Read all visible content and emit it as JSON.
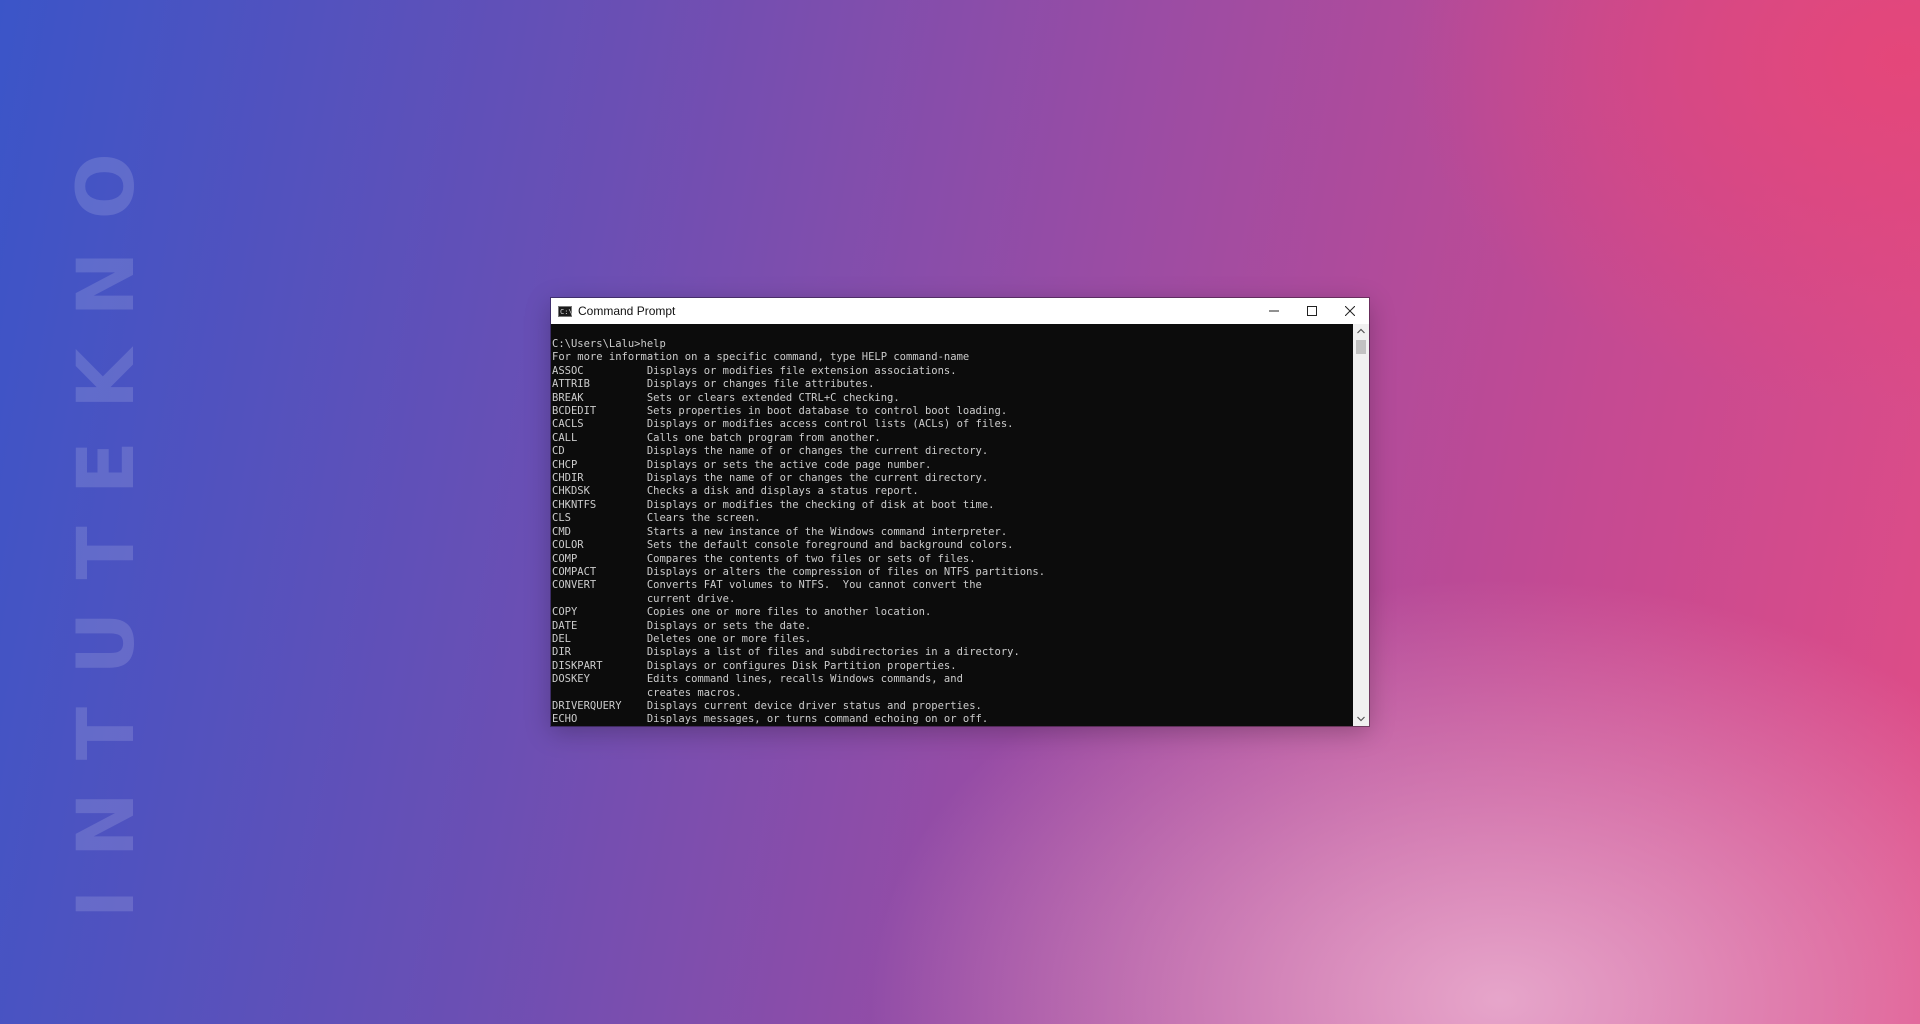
{
  "background": {
    "watermark_text": "INTUTEKNO",
    "colors": [
      "#3b55c8",
      "#9a4ca4",
      "#e04c86",
      "#e8aacd"
    ]
  },
  "window": {
    "title": "Command Prompt",
    "app_icon": "cmd-icon",
    "app_icon_glyph": "C:\\",
    "controls": [
      "minimize-icon",
      "maximize-icon",
      "close-icon"
    ]
  },
  "console": {
    "lines": [
      "C:\\Users\\Lalu>help",
      "For more information on a specific command, type HELP command-name",
      "ASSOC          Displays or modifies file extension associations.",
      "ATTRIB         Displays or changes file attributes.",
      "BREAK          Sets or clears extended CTRL+C checking.",
      "BCDEDIT        Sets properties in boot database to control boot loading.",
      "CACLS          Displays or modifies access control lists (ACLs) of files.",
      "CALL           Calls one batch program from another.",
      "CD             Displays the name of or changes the current directory.",
      "CHCP           Displays or sets the active code page number.",
      "CHDIR          Displays the name of or changes the current directory.",
      "CHKDSK         Checks a disk and displays a status report.",
      "CHKNTFS        Displays or modifies the checking of disk at boot time.",
      "CLS            Clears the screen.",
      "CMD            Starts a new instance of the Windows command interpreter.",
      "COLOR          Sets the default console foreground and background colors.",
      "COMP           Compares the contents of two files or sets of files.",
      "COMPACT        Displays or alters the compression of files on NTFS partitions.",
      "CONVERT        Converts FAT volumes to NTFS.  You cannot convert the",
      "               current drive.",
      "COPY           Copies one or more files to another location.",
      "DATE           Displays or sets the date.",
      "DEL            Deletes one or more files.",
      "DIR            Displays a list of files and subdirectories in a directory.",
      "DISKPART       Displays or configures Disk Partition properties.",
      "DOSKEY         Edits command lines, recalls Windows commands, and",
      "               creates macros.",
      "DRIVERQUERY    Displays current device driver status and properties.",
      "ECHO           Displays messages, or turns command echoing on or off."
    ],
    "colors": {
      "background": "#0c0c0c",
      "text": "#cccccc"
    }
  },
  "scrollbar": {
    "up_icon": "chevron-up-icon",
    "down_icon": "chevron-down-icon",
    "position_fraction": 0.0
  }
}
